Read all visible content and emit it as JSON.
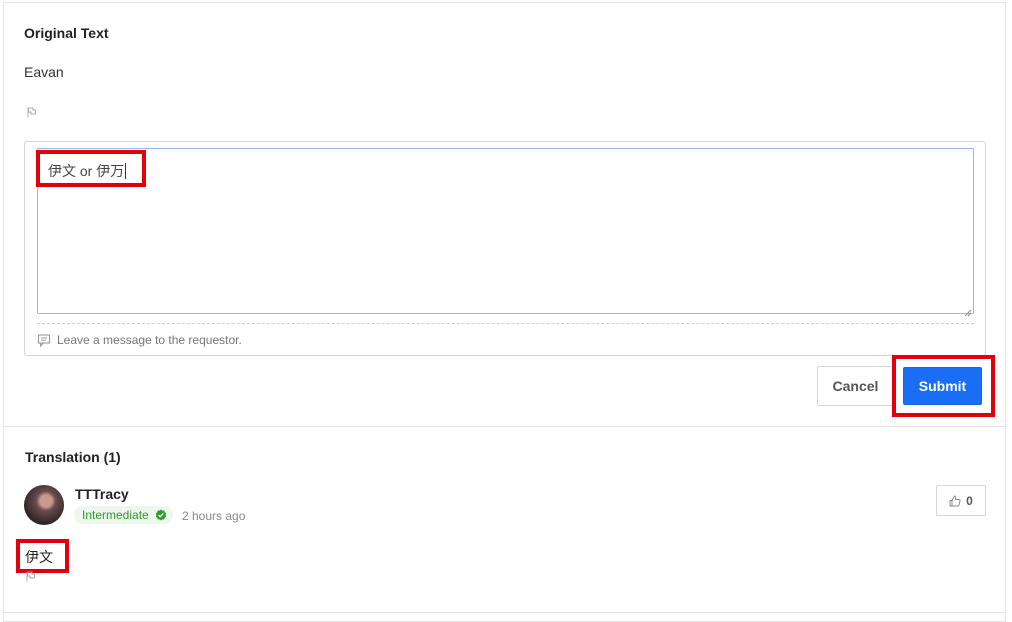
{
  "original": {
    "title": "Original Text",
    "text": "Eavan"
  },
  "editor": {
    "value": "伊文 or 伊万",
    "message_placeholder": "Leave a message to the requestor."
  },
  "actions": {
    "cancel_label": "Cancel",
    "submit_label": "Submit"
  },
  "translations": {
    "title": "Translation (1)",
    "items": [
      {
        "username": "TTTracy",
        "level": "Intermediate",
        "time": "2 hours ago",
        "likes": "0",
        "text": "伊文"
      }
    ]
  },
  "colors": {
    "accent": "#1a6ef5",
    "highlight": "#e3000b",
    "level_green": "#2a9d2a"
  },
  "icons": [
    "flag-icon",
    "comment-icon",
    "verified-check-icon",
    "thumbs-up-icon",
    "resize-handle-icon"
  ]
}
